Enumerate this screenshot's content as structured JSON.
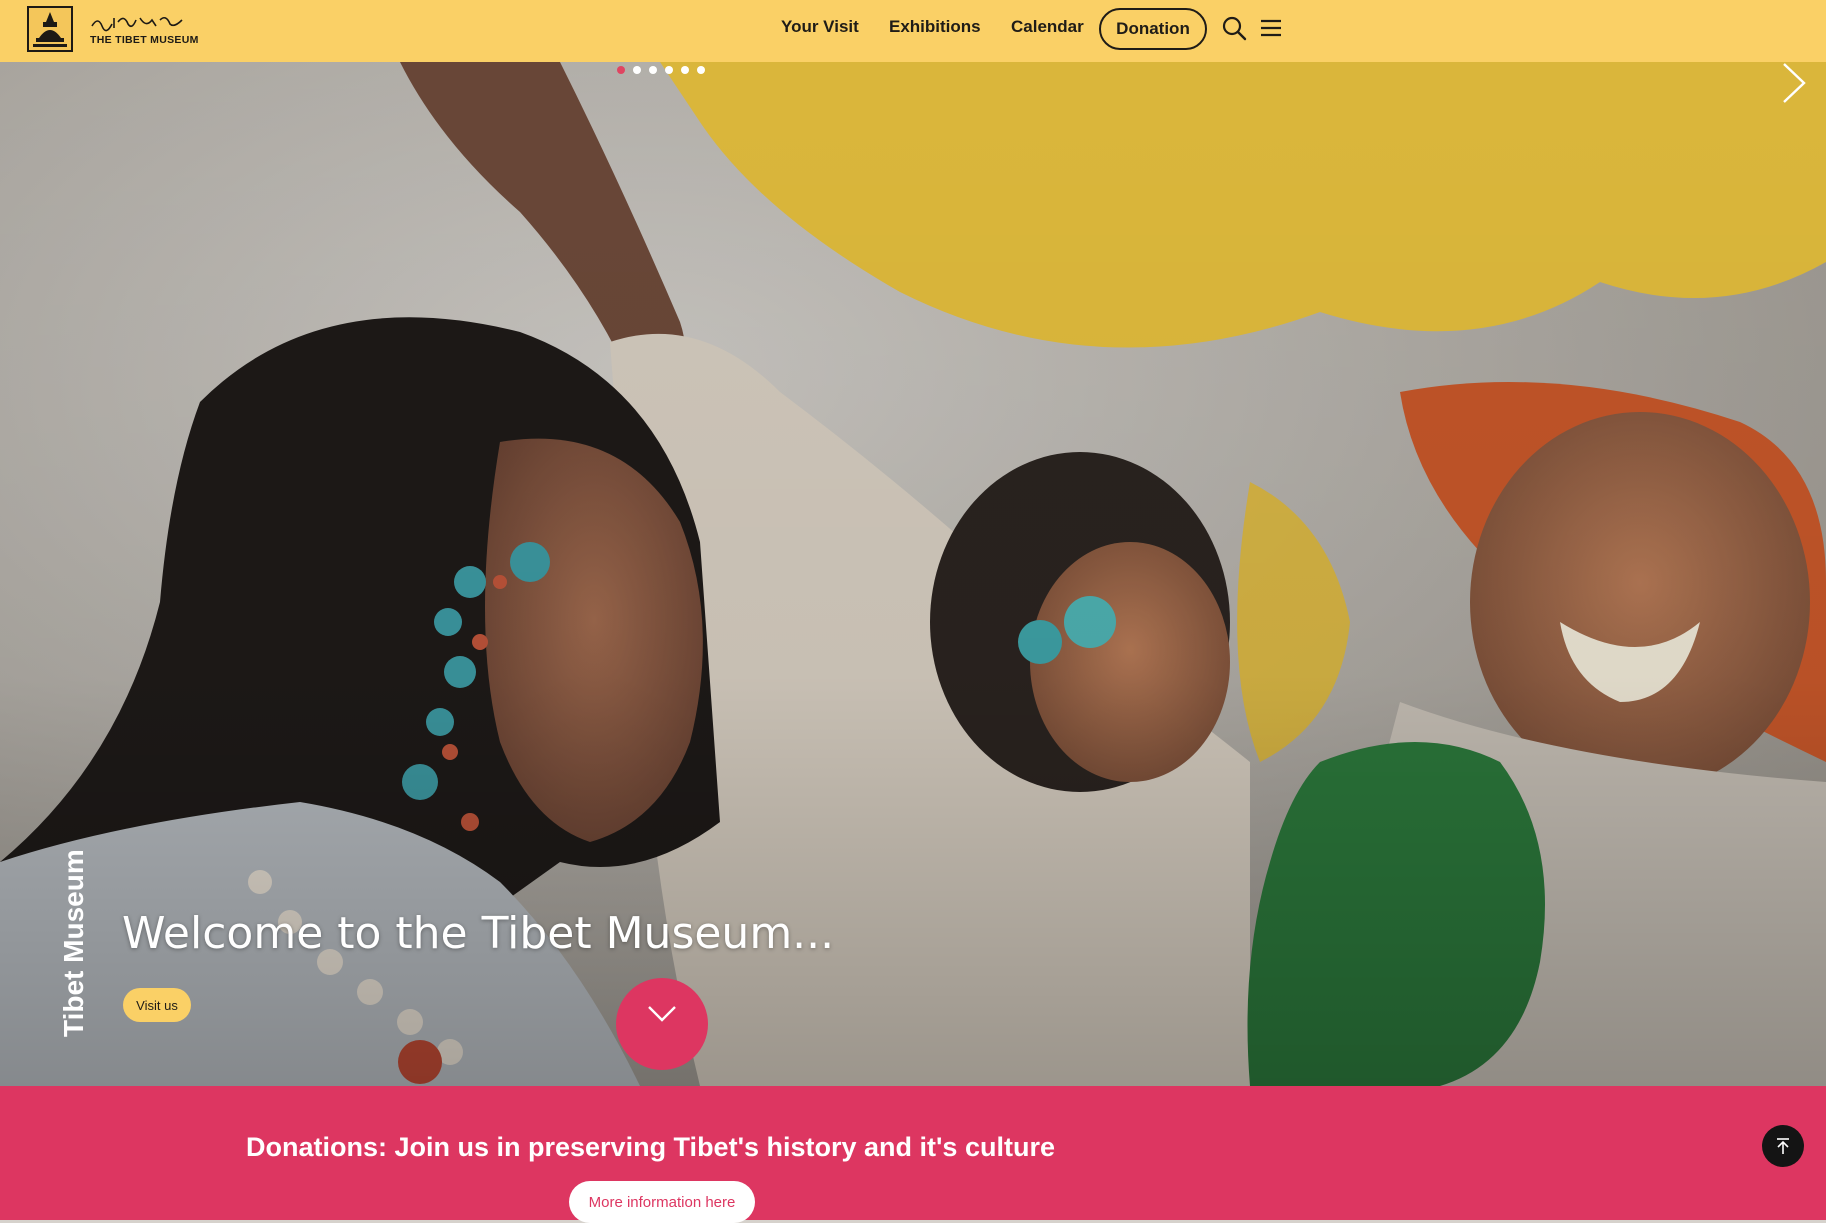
{
  "header": {
    "logo_text": "THE TIBET MUSEUM",
    "logo_script_text": "ཀླུ་ཡི་ཤིང་ཙན",
    "nav": [
      {
        "label": "Your Visit"
      },
      {
        "label": "Exhibitions"
      },
      {
        "label": "Calendar"
      }
    ],
    "donation_label": "Donation",
    "search_icon": "search-icon",
    "menu_icon": "hamburger-menu-icon",
    "background_color": "#fad066"
  },
  "hero": {
    "slides_total": 6,
    "active_slide": 1,
    "vertical_title": "Tibet Museum",
    "welcome_text": "Welcome to the Tibet Museum...",
    "visit_label": "Visit us",
    "next_icon": "chevron-right-icon",
    "scroll_icon": "chevron-down-icon"
  },
  "banner": {
    "title": "Donations: Join us in preserving Tibet's history and it's culture",
    "more_label": "More information here",
    "background_color": "#dd3661",
    "to_top_icon": "arrow-up-to-top-icon"
  }
}
